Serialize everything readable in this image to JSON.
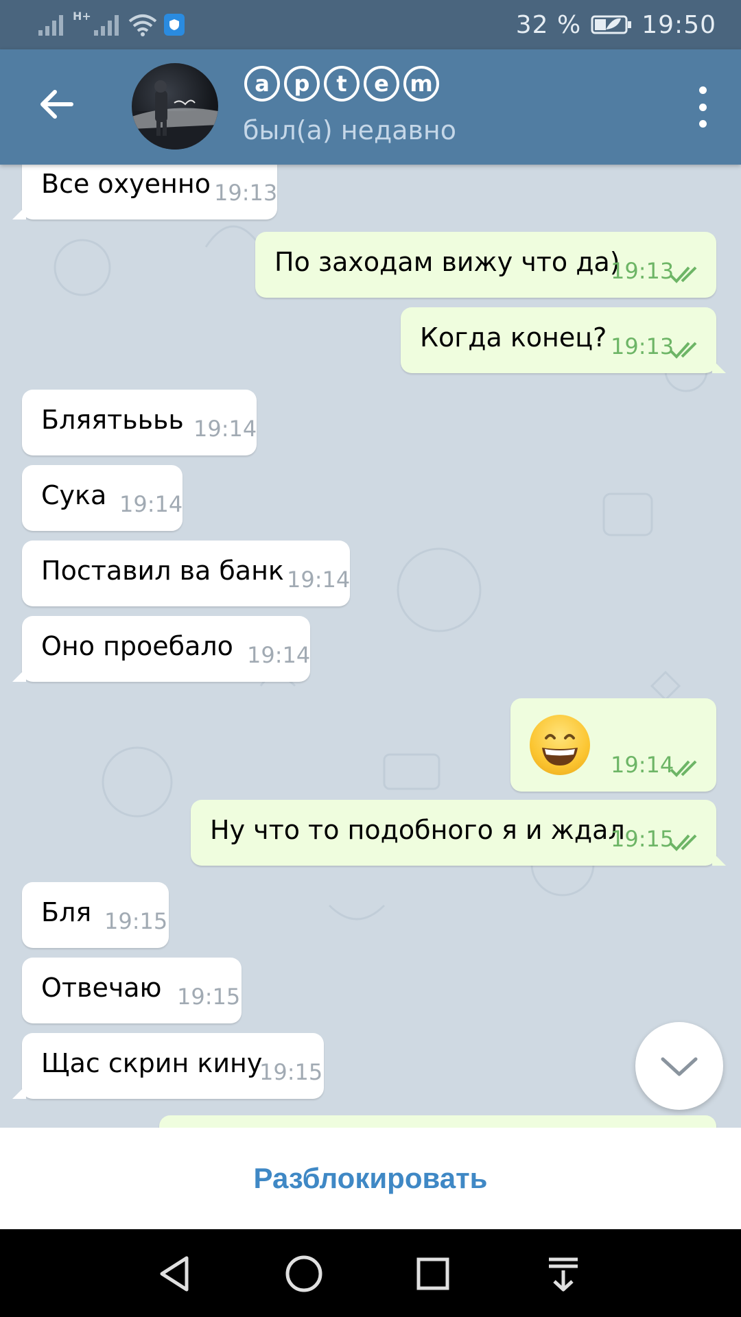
{
  "status_bar": {
    "network_label": "H+",
    "battery_percent": "32 %",
    "time": "19:50"
  },
  "header": {
    "title_letters": [
      "a",
      "p",
      "t",
      "e",
      "m"
    ],
    "subtitle": "был(а) недавно"
  },
  "messages": [
    {
      "dir": "in",
      "text": "Все охуенно",
      "time": "19:13"
    },
    {
      "dir": "out",
      "text": "По заходам вижу что да)",
      "time": "19:13",
      "read": true
    },
    {
      "dir": "out",
      "text": "Когда конец?",
      "time": "19:13",
      "read": true
    },
    {
      "dir": "in",
      "text": "Бляятьььь",
      "time": "19:14"
    },
    {
      "dir": "in",
      "text": "Сука",
      "time": "19:14"
    },
    {
      "dir": "in",
      "text": "Поставил ва банк",
      "time": "19:14"
    },
    {
      "dir": "in",
      "text": "Оно проебало",
      "time": "19:14"
    },
    {
      "dir": "out",
      "emoji": "grinning-face",
      "time": "19:14",
      "read": true
    },
    {
      "dir": "out",
      "text": "Ну что то подобного я и ждал",
      "time": "19:15",
      "read": true
    },
    {
      "dir": "in",
      "text": "Бля",
      "time": "19:15"
    },
    {
      "dir": "in",
      "text": "Отвечаю",
      "time": "19:15"
    },
    {
      "dir": "in",
      "text": "Щас скрин кину",
      "time": "19:15"
    }
  ],
  "unblock_label": "Разблокировать",
  "colors": {
    "header": "#517da2",
    "status_bar": "#4a657e",
    "outgoing_bubble": "#effdde",
    "incoming_bubble": "#ffffff",
    "accent": "#3f88c5",
    "read_ticks": "#6db566"
  },
  "icons": {
    "back": "arrow-left-icon",
    "menu": "more-vertical-icon",
    "scroll": "chevron-down-icon",
    "nav": [
      "back-triangle-icon",
      "home-circle-icon",
      "recents-square-icon",
      "notifications-icon"
    ]
  }
}
